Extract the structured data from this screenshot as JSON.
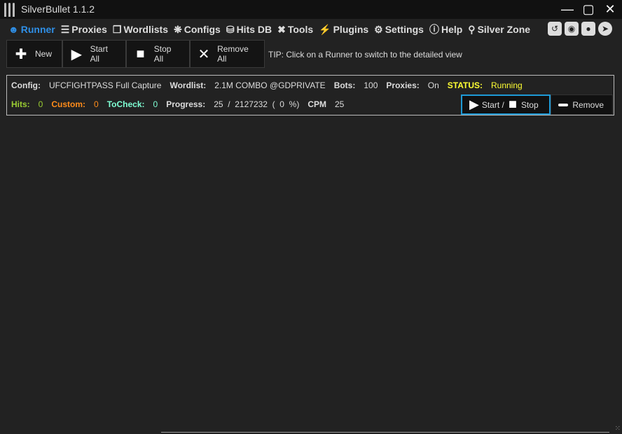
{
  "app": {
    "title": "SilverBullet 1.1.2"
  },
  "nav": [
    {
      "label": "Runner",
      "icon": "worker-icon",
      "active": true
    },
    {
      "label": "Proxies",
      "icon": "server-icon"
    },
    {
      "label": "Wordlists",
      "icon": "files-icon"
    },
    {
      "label": "Configs",
      "icon": "gear-wheel-icon"
    },
    {
      "label": "Hits DB",
      "icon": "database-icon"
    },
    {
      "label": "Tools",
      "icon": "tools-icon"
    },
    {
      "label": "Plugins",
      "icon": "plug-icon"
    },
    {
      "label": "Settings",
      "icon": "gear-icon"
    },
    {
      "label": "Help",
      "icon": "help-icon"
    },
    {
      "label": "Silver Zone",
      "icon": "location-icon"
    }
  ],
  "toolbar": {
    "new": "New",
    "start_all": "Start All",
    "stop_all": "Stop All",
    "remove_all": "Remove All",
    "tip": "TIP: Click on a Runner to switch to the detailed view"
  },
  "runner": {
    "config_label": "Config:",
    "config": "UFCFIGHTPASS Full Capture",
    "wordlist_label": "Wordlist:",
    "wordlist": "2.1M COMBO @GDPRIVATE",
    "bots_label": "Bots:",
    "bots": "100",
    "proxies_label": "Proxies:",
    "proxies": "On",
    "status_label": "STATUS:",
    "status": "Running",
    "hits_label": "Hits:",
    "hits": "0",
    "custom_label": "Custom:",
    "custom": "0",
    "tocheck_label": "ToCheck:",
    "tocheck": "0",
    "progress_label": "Progress:",
    "progress": "25  /  2127232  (  0  %)",
    "cpm_label": "CPM",
    "cpm": "25",
    "start_label": "Start /",
    "stop_label": "Stop",
    "remove_label": "Remove"
  },
  "colors": {
    "accent": "#2f8fe6",
    "hits": "#9acd32",
    "custom": "#ff8c1a",
    "tocheck": "#7fffd4",
    "status": "#ffff33"
  }
}
